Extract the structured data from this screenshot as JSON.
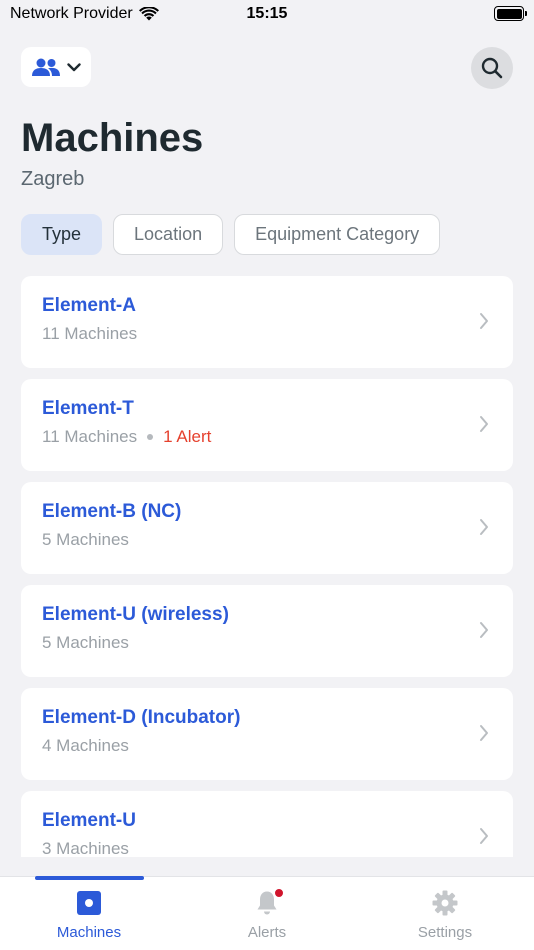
{
  "status_bar": {
    "carrier": "Network Provider",
    "time": "15:15"
  },
  "header": {
    "title": "Machines",
    "subtitle": "Zagreb"
  },
  "filters": [
    {
      "label": "Type",
      "active": true
    },
    {
      "label": "Location",
      "active": false
    },
    {
      "label": "Equipment Category",
      "active": false
    }
  ],
  "machine_groups": [
    {
      "name": "Element-A",
      "count": "11 Machines",
      "alert": ""
    },
    {
      "name": "Element-T",
      "count": "11 Machines",
      "alert": "1 Alert"
    },
    {
      "name": "Element-B (NC)",
      "count": "5 Machines",
      "alert": ""
    },
    {
      "name": "Element-U (wireless)",
      "count": "5 Machines",
      "alert": ""
    },
    {
      "name": "Element-D (Incubator)",
      "count": "4 Machines",
      "alert": ""
    },
    {
      "name": "Element-U",
      "count": "3 Machines",
      "alert": ""
    }
  ],
  "tabbar": {
    "tabs": [
      {
        "label": "Machines",
        "icon": "machines-icon",
        "active": true
      },
      {
        "label": "Alerts",
        "icon": "bell-icon",
        "active": false
      },
      {
        "label": "Settings",
        "icon": "gear-icon",
        "active": false
      }
    ]
  },
  "colors": {
    "accent": "#2c5ad8",
    "alert": "#e5412e",
    "background": "#f2f2f5"
  }
}
